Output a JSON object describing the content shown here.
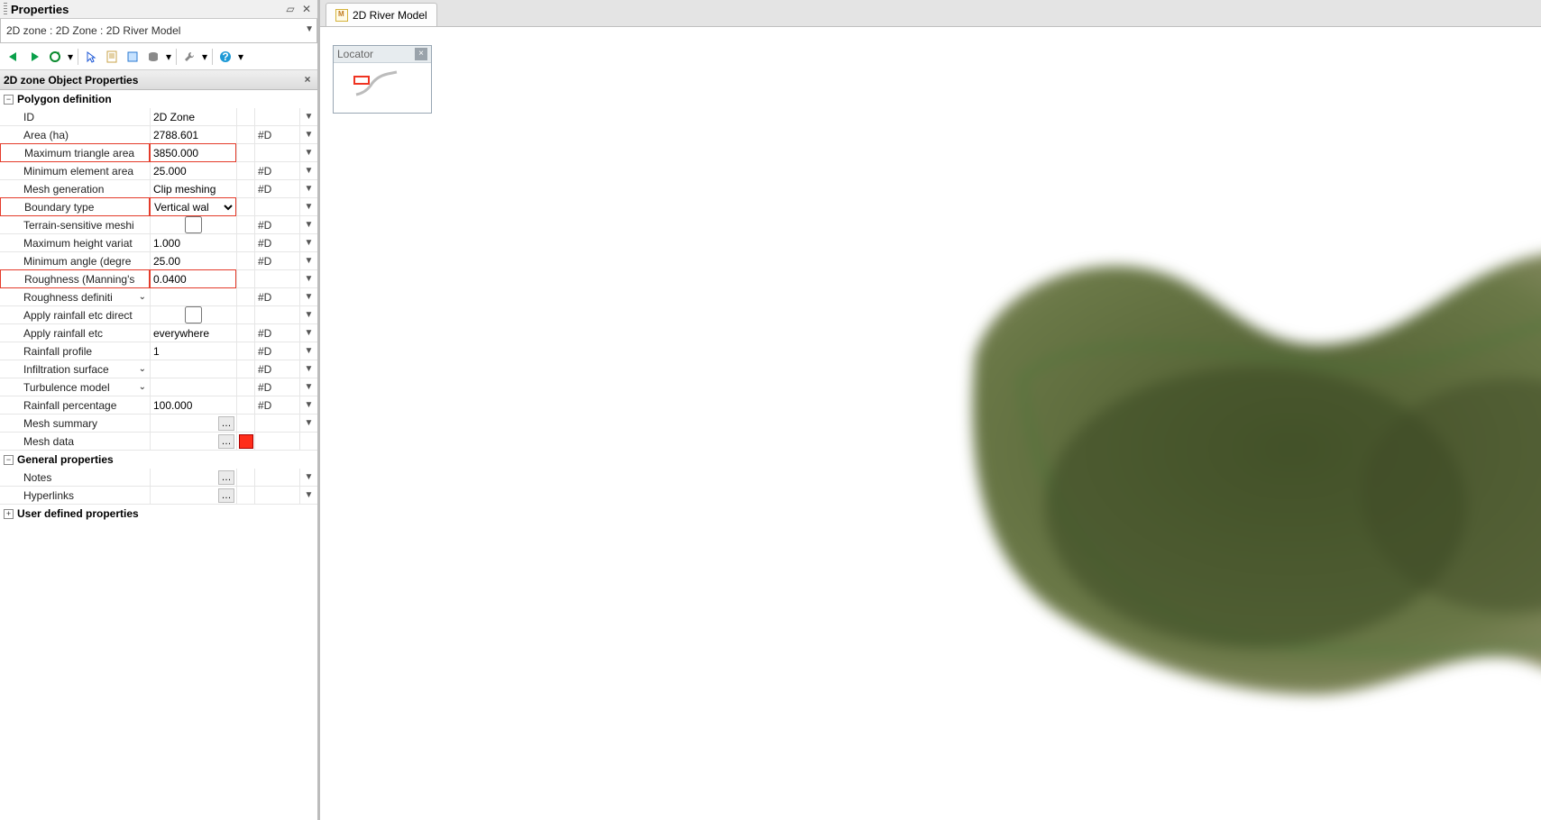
{
  "panel": {
    "title": "Properties",
    "breadcrumb": "2D zone : 2D Zone : 2D River Model",
    "subheader": "2D zone Object Properties"
  },
  "tab": {
    "label": "2D River Model"
  },
  "locator": {
    "label": "Locator"
  },
  "sections": {
    "polygon": {
      "title": "Polygon definition",
      "expanded": true
    },
    "general": {
      "title": "General properties",
      "expanded": true
    },
    "user": {
      "title": "User defined properties",
      "expanded": false
    }
  },
  "rows": {
    "id": {
      "label": "ID",
      "value": "2D Zone",
      "d": ""
    },
    "area": {
      "label": "Area (ha)",
      "value": "2788.601",
      "d": "#D"
    },
    "maxtri": {
      "label": "Maximum triangle area",
      "value": "3850.000",
      "d": ""
    },
    "minel": {
      "label": "Minimum element area",
      "value": "25.000",
      "d": "#D"
    },
    "meshgen": {
      "label": "Mesh generation",
      "value": "Clip meshing",
      "d": "#D"
    },
    "bound": {
      "label": "Boundary type",
      "value": "Vertical wal",
      "d": ""
    },
    "terr": {
      "label": "Terrain-sensitive meshi",
      "value": "",
      "d": "#D"
    },
    "maxh": {
      "label": "Maximum height variat",
      "value": "1.000",
      "d": "#D"
    },
    "minang": {
      "label": "Minimum angle (degre",
      "value": "25.00",
      "d": "#D"
    },
    "rough": {
      "label": "Roughness (Manning's",
      "value": "0.0400",
      "d": ""
    },
    "roughdef": {
      "label": "Roughness definiti",
      "value": "",
      "d": "#D"
    },
    "rain": {
      "label": "Apply rainfall etc direct",
      "value": "",
      "d": ""
    },
    "rainev": {
      "label": "Apply rainfall etc",
      "value": "everywhere",
      "d": "#D"
    },
    "rainprof": {
      "label": "Rainfall profile",
      "value": "1",
      "d": "#D"
    },
    "infil": {
      "label": "Infiltration surface",
      "value": "",
      "d": "#D"
    },
    "turb": {
      "label": "Turbulence model",
      "value": "",
      "d": "#D"
    },
    "rainpc": {
      "label": "Rainfall percentage",
      "value": "100.000",
      "d": "#D"
    },
    "meshsum": {
      "label": "Mesh summary",
      "value": "",
      "d": ""
    },
    "meshdata": {
      "label": "Mesh data",
      "value": "",
      "d": ""
    },
    "notes": {
      "label": "Notes",
      "value": "",
      "d": ""
    },
    "links": {
      "label": "Hyperlinks",
      "value": "",
      "d": ""
    }
  }
}
